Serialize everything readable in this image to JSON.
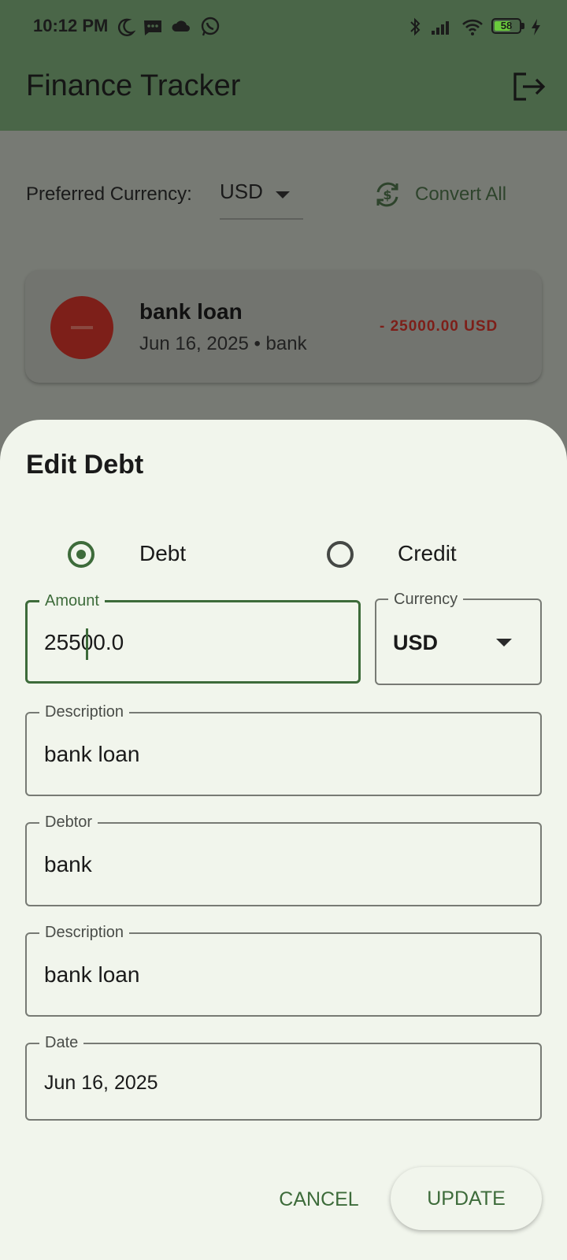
{
  "status_bar": {
    "time": "10:12 PM",
    "icons": [
      "moon-icon",
      "message-icon",
      "cloud-icon",
      "whatsapp-icon",
      "bluetooth-icon",
      "signal-icon",
      "wifi-icon",
      "battery-icon",
      "charging-icon"
    ],
    "battery_level": "58"
  },
  "app_bar": {
    "title": "Finance Tracker",
    "logout_icon": "logout-icon"
  },
  "currency_bar": {
    "label": "Preferred Currency:",
    "selected": "USD",
    "convert_label": "Convert All",
    "convert_icon": "currency-exchange-icon"
  },
  "transaction": {
    "title": "bank loan",
    "subtitle": "Jun 16, 2025 • bank",
    "amount": "- 25000.00 USD",
    "type_icon": "minus-icon",
    "color": "#7d1f19"
  },
  "sheet": {
    "title": "Edit Debt",
    "type_options": [
      {
        "label": "Debt",
        "selected": true
      },
      {
        "label": "Credit",
        "selected": false
      }
    ],
    "amount": {
      "label": "Amount",
      "value": "25500.0"
    },
    "currency": {
      "label": "Currency",
      "value": "USD"
    },
    "description": {
      "label": "Description",
      "value": "bank loan"
    },
    "debtor": {
      "label": "Debtor",
      "value": "bank"
    },
    "description2": {
      "label": "Description",
      "value": "bank loan"
    },
    "date": {
      "label": "Date",
      "value": "Jun 16, 2025"
    },
    "cancel_label": "CANCEL",
    "update_label": "UPDATE"
  },
  "colors": {
    "app_bar": "#4a6648",
    "accent": "#3d6b3a",
    "sheet_bg": "#f1f5ec",
    "debt_red": "#7d1f19"
  }
}
